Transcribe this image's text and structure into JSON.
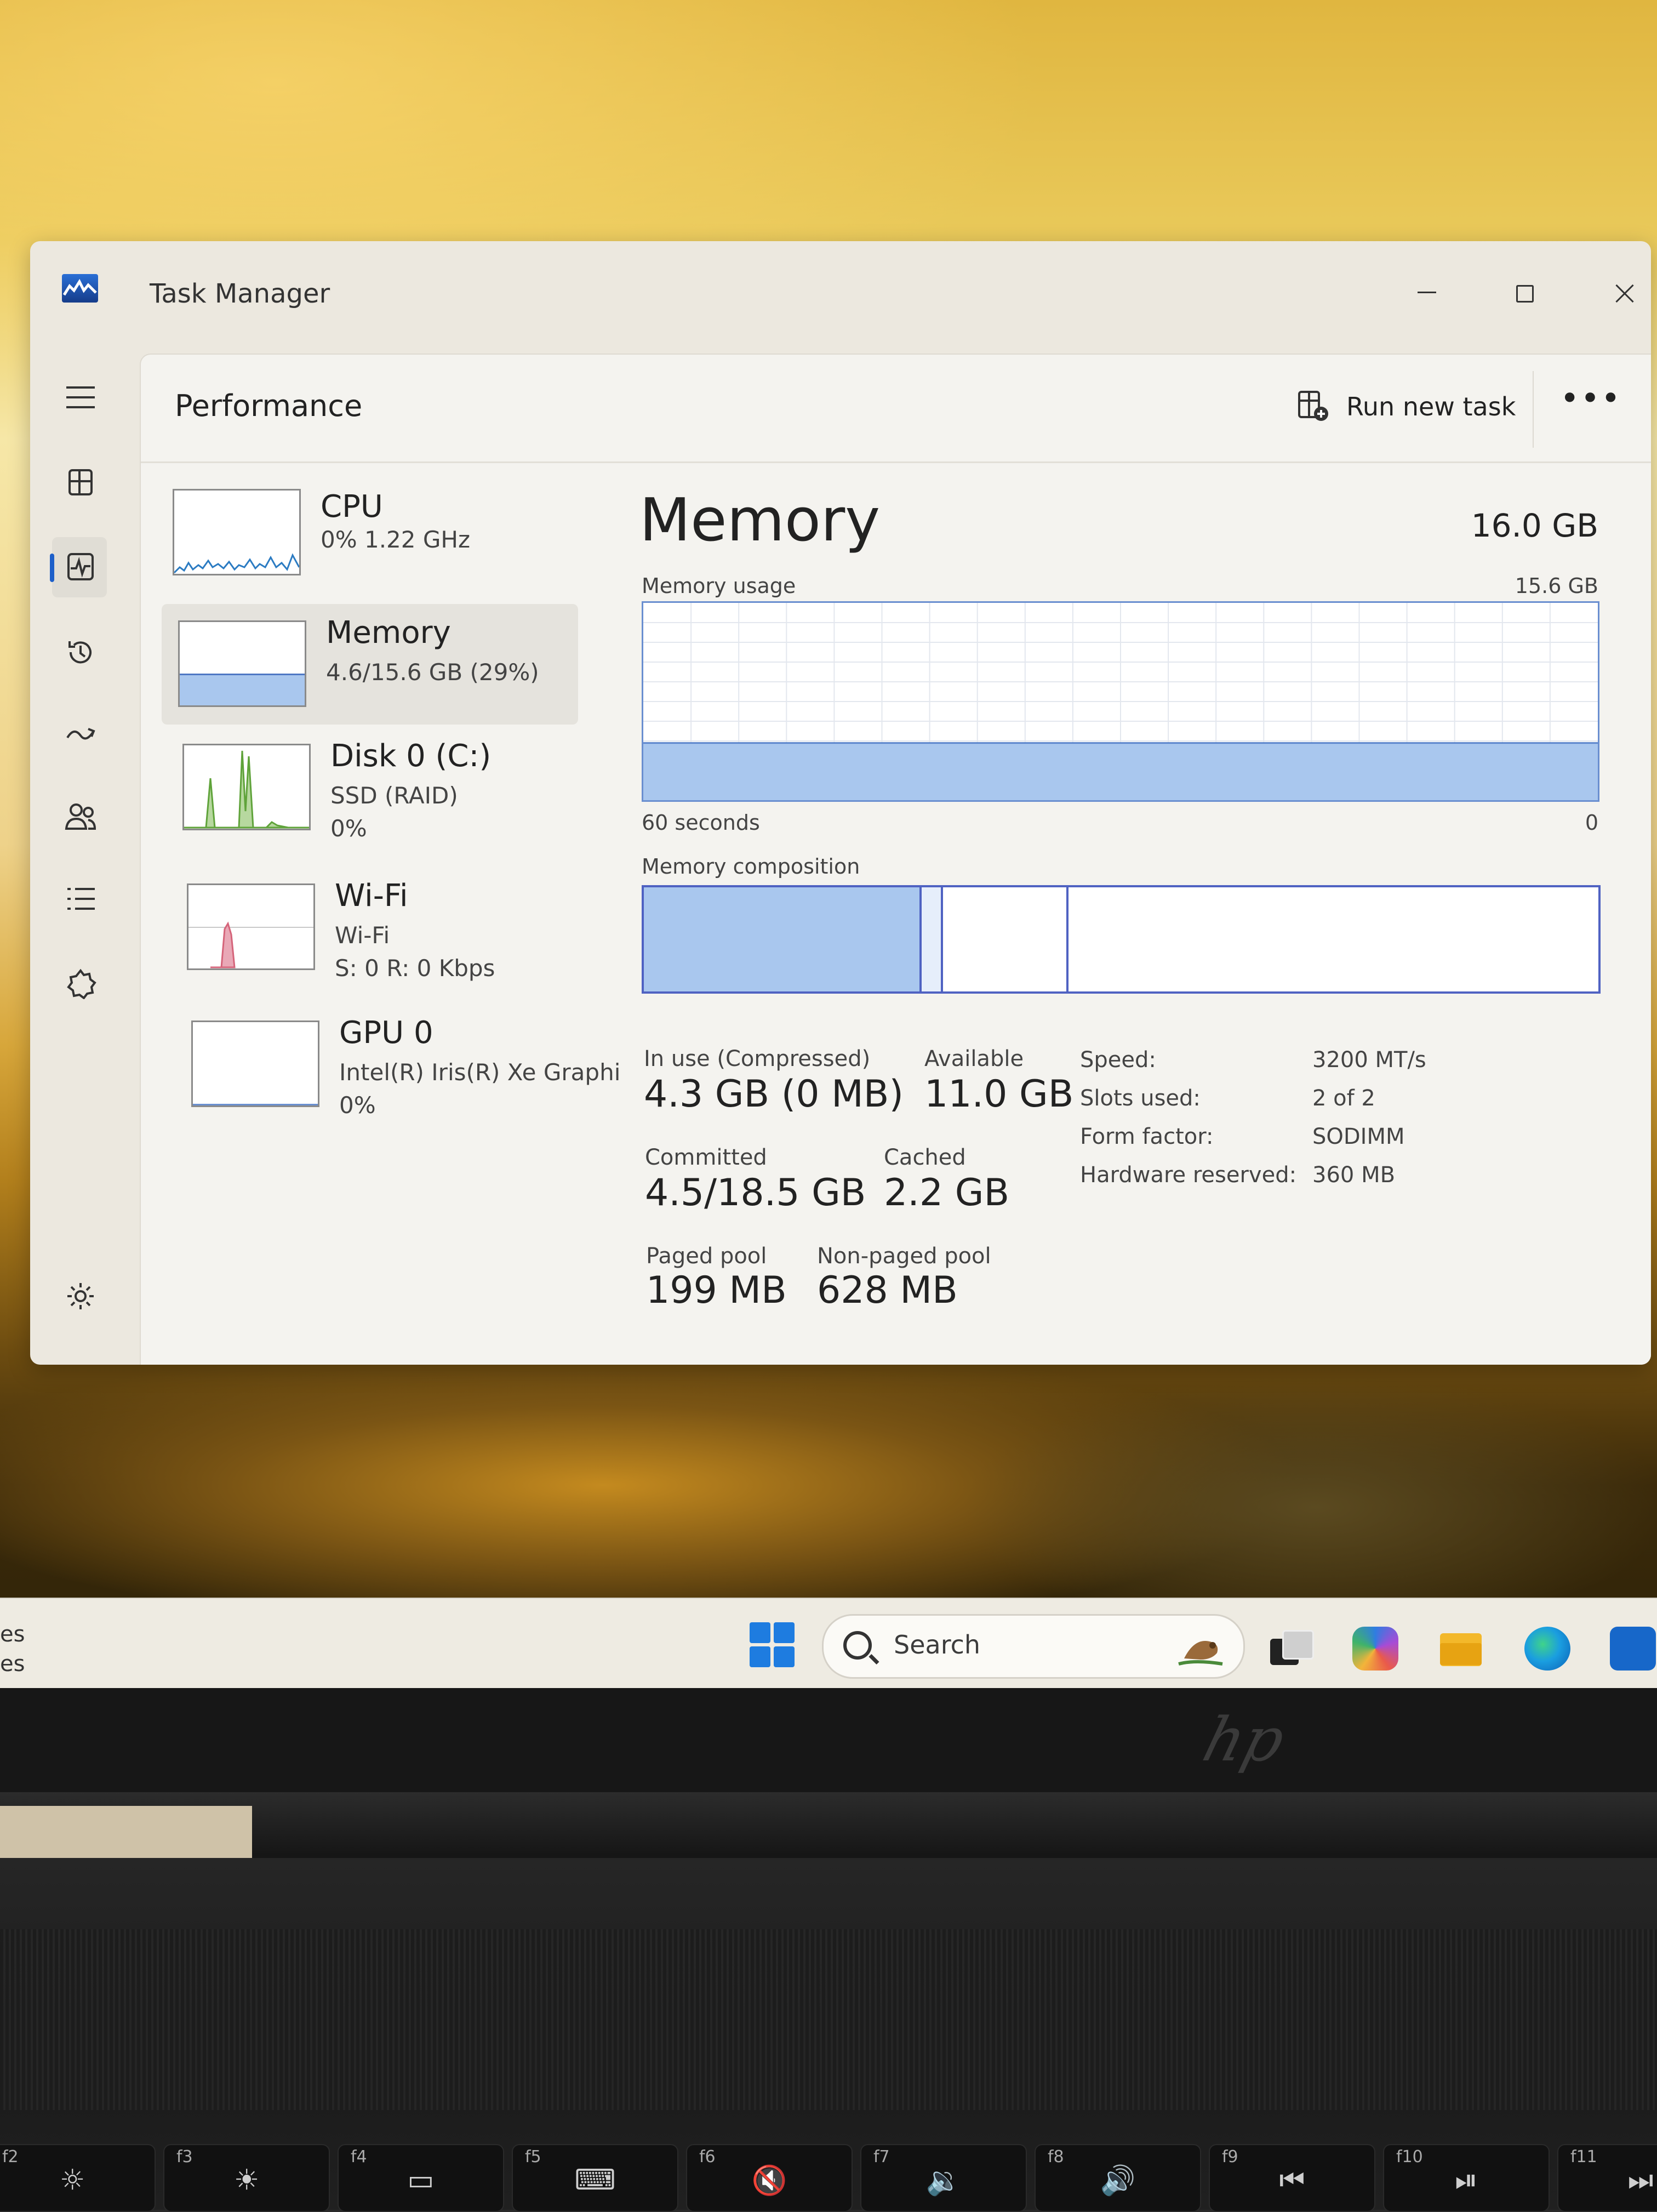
{
  "window": {
    "title": "Task Manager"
  },
  "taskbar": {
    "search_label": "Search",
    "left_clip_lines": [
      "es",
      "es"
    ]
  },
  "laptop": {
    "brand": "hp"
  },
  "keyboard": {
    "keys": [
      {
        "fn": "f2",
        "glyph": "☼"
      },
      {
        "fn": "f3",
        "glyph": "☀"
      },
      {
        "fn": "f4",
        "glyph": "▭"
      },
      {
        "fn": "f5",
        "glyph": "⌨"
      },
      {
        "fn": "f6",
        "glyph": "🔇"
      },
      {
        "fn": "f7",
        "glyph": "🔉"
      },
      {
        "fn": "f8",
        "glyph": "🔊"
      },
      {
        "fn": "f9",
        "glyph": "⏮"
      },
      {
        "fn": "f10",
        "glyph": "⏯"
      },
      {
        "fn": "f11",
        "glyph": "⏭"
      }
    ]
  },
  "header": {
    "title": "Performance",
    "run_new_task": "Run new task",
    "more": "•••"
  },
  "nav": [
    "hamburger-menu-icon",
    "processes-icon",
    "performance-icon",
    "app-history-icon",
    "startup-apps-icon",
    "users-icon",
    "details-icon",
    "services-icon",
    "settings-icon"
  ],
  "devices": {
    "cpu": {
      "name": "CPU",
      "sub1": "0%  1.22 GHz"
    },
    "memory": {
      "name": "Memory",
      "sub1": "4.6/15.6 GB (29%)"
    },
    "disk": {
      "name": "Disk 0 (C:)",
      "sub1": "SSD (RAID)",
      "sub2": "0%"
    },
    "wifi": {
      "name": "Wi-Fi",
      "sub1": "Wi-Fi",
      "sub2": "S: 0  R: 0 Kbps"
    },
    "gpu": {
      "name": "GPU 0",
      "sub1": "Intel(R) Iris(R) Xe Graphi",
      "sub2": "0%"
    }
  },
  "memory": {
    "title": "Memory",
    "total": "16.0 GB",
    "usage_label": "Memory usage",
    "usage_max": "15.6 GB",
    "x_left": "60 seconds",
    "x_right": "0",
    "composition_label": "Memory composition",
    "composition": {
      "in_use_fraction": 0.29,
      "modified_fraction": 0.02,
      "standby_fraction": 0.13
    },
    "stats": {
      "in_use_label": "In use (Compressed)",
      "in_use_value": "4.3 GB (0 MB)",
      "available_label": "Available",
      "available_value": "11.0 GB",
      "committed_label": "Committed",
      "committed_value": "4.5/18.5 GB",
      "cached_label": "Cached",
      "cached_value": "2.2 GB",
      "paged_label": "Paged pool",
      "paged_value": "199 MB",
      "nonpaged_label": "Non-paged pool",
      "nonpaged_value": "628 MB"
    },
    "specs": {
      "speed_k": "Speed:",
      "speed_v": "3200 MT/s",
      "slots_k": "Slots used:",
      "slots_v": "2 of 2",
      "form_k": "Form factor:",
      "form_v": "SODIMM",
      "hw_k": "Hardware reserved:",
      "hw_v": "360 MB"
    }
  },
  "colors": {
    "accent": "#1d5fc9",
    "memory_fill": "#a9c7ee",
    "memory_border": "#4f62c2",
    "disk_green": "#77b84e",
    "wifi_pink": "#d5647a"
  }
}
